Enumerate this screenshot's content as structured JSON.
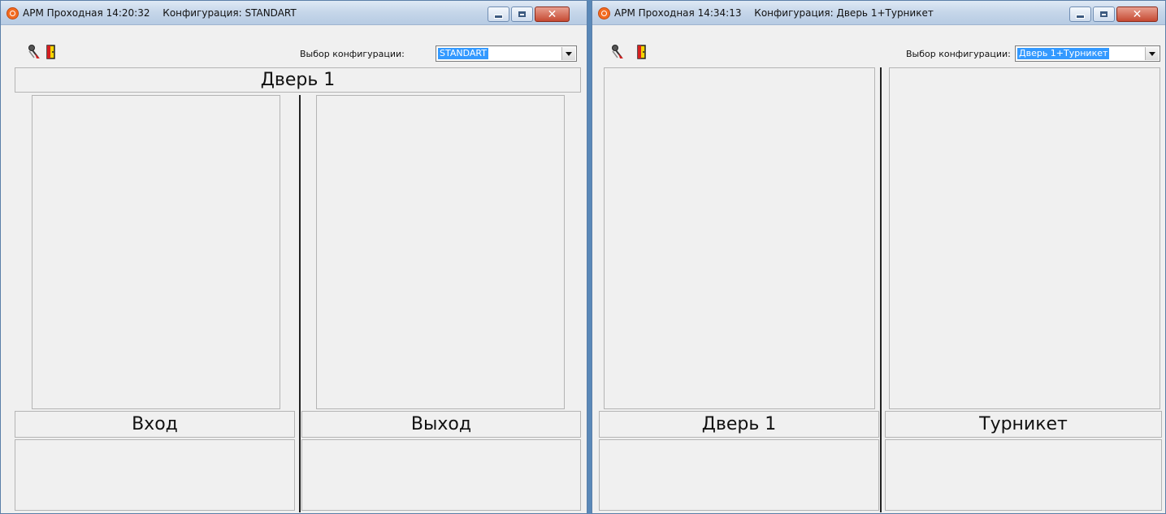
{
  "left_window": {
    "title_app": "АРМ Проходная 14:20:32",
    "title_config": "Конфигурация: STANDART",
    "config_label": "Выбор конфигурации:",
    "config_value": "STANDART",
    "door_title": "Дверь 1",
    "col_left_label": "Вход",
    "col_right_label": "Выход"
  },
  "right_window": {
    "title_app": "АРМ Проходная 14:34:13",
    "title_config": "Конфигурация: Дверь 1+Турникет",
    "config_label": "Выбор конфигурации:",
    "config_value": "Дверь 1+Турникет",
    "col_left_label": "Дверь 1",
    "col_right_label": "Турникет"
  },
  "icons": {
    "tool_1": "key-settings-icon",
    "tool_2": "door-exit-icon",
    "close": "close-icon",
    "minimize": "minimize-icon",
    "maximize": "maximize-icon"
  },
  "colors": {
    "selection": "#3399ff",
    "close_button": "#c64a33",
    "app_icon": "#f26b21"
  }
}
